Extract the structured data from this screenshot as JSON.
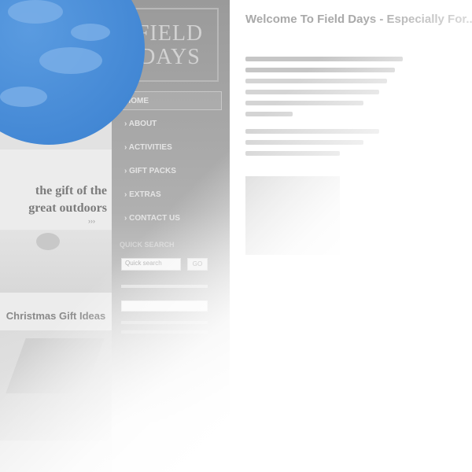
{
  "logo": {
    "line1": "FIELD",
    "line2": "DAYS"
  },
  "nav": [
    {
      "label": "HOME",
      "active": true
    },
    {
      "label": "› ABOUT"
    },
    {
      "label": "› ACTIVITIES"
    },
    {
      "label": "› GIFT PACKS"
    },
    {
      "label": "› EXTRAS"
    },
    {
      "label": "› CONTACT US"
    }
  ],
  "quick_search": {
    "title": "QUICK SEARCH",
    "placeholder": "Quick search",
    "button": "GO"
  },
  "promo": {
    "line1": "the gift of the",
    "line2": "great outdoors",
    "sub": "›››"
  },
  "xmas": {
    "title": "Christmas Gift Ideas"
  },
  "main": {
    "title": "Welcome To Field Days - Especially For..."
  },
  "colors": {
    "sky": "#3a80d0",
    "sidebar": "#9a9a9a"
  }
}
